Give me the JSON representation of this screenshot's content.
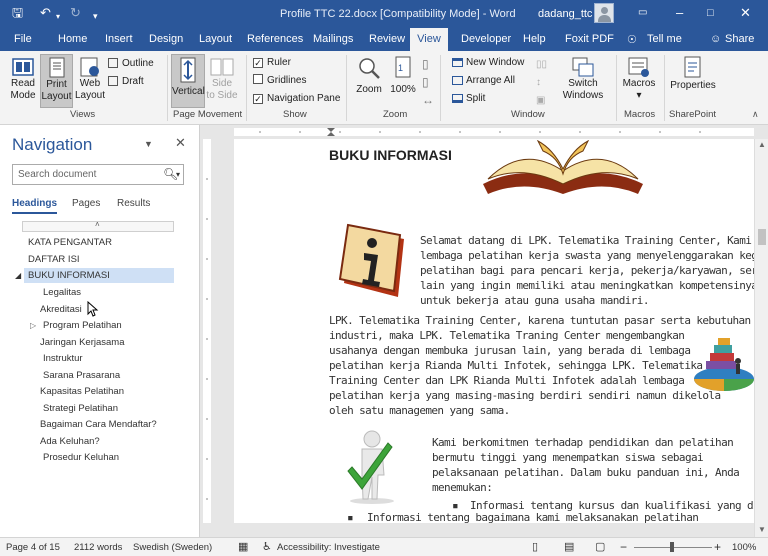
{
  "titlebar": {
    "title": "Profile TTC 22.docx [Compatibility Mode] - Word",
    "user": "dadang_ttc"
  },
  "tabs": [
    "File",
    "Home",
    "Insert",
    "Design",
    "Layout",
    "References",
    "Mailings",
    "Review",
    "View",
    "Developer",
    "Help",
    "Foxit PDF",
    "Tell me",
    "Share"
  ],
  "ribbon": {
    "views": {
      "read_mode": [
        "Read",
        "Mode"
      ],
      "print_layout": [
        "Print",
        "Layout"
      ],
      "web_layout": [
        "Web",
        "Layout"
      ],
      "outline": "Outline",
      "draft": "Draft",
      "group": "Views"
    },
    "page_movement": {
      "vertical": "Vertical",
      "side_to_side": [
        "Side",
        "to Side"
      ],
      "group": "Page Movement"
    },
    "show": {
      "ruler": "Ruler",
      "gridlines": "Gridlines",
      "navigation_pane": "Navigation Pane",
      "group": "Show"
    },
    "zoom": {
      "zoom": "Zoom",
      "percent": "100%",
      "group": "Zoom"
    },
    "window": {
      "new_window": "New Window",
      "arrange_all": "Arrange All",
      "split": "Split",
      "switch_windows": [
        "Switch",
        "Windows"
      ],
      "group": "Window"
    },
    "macros": {
      "label": "Macros",
      "group": "Macros"
    },
    "sharepoint": {
      "label": "Properties",
      "group": "SharePoint"
    }
  },
  "navigation": {
    "title": "Navigation",
    "search_placeholder": "Search document",
    "tabs": [
      "Headings",
      "Pages",
      "Results"
    ],
    "headings": [
      "KATA PENGANTAR",
      "DAFTAR ISI",
      "BUKU INFORMASI",
      "Legalitas",
      "Akreditasi",
      "Program Pelatihan",
      "Jaringan Kerjasama",
      "Instruktur",
      "Sarana Prasarana",
      "Kapasitas Pelatihan",
      "Strategi Pelatihan",
      "Bagaiman Cara Mendaftar?",
      "Ada Keluhan?",
      "Prosedur Keluhan"
    ]
  },
  "document": {
    "heading": "BUKU INFORMASI",
    "para1": [
      "Selamat datang di LPK. Telematika Training Center, Kami ad",
      "lembaga pelatihan kerja swasta yang menyelenggarakan keg",
      "pelatihan bagi para pencari kerja, pekerja/karyawan, serta",
      "lain yang ingin memiliki atau meningkatkan kompetensinya",
      "untuk bekerja atau guna usaha mandiri."
    ],
    "para2": [
      "LPK. Telematika Training Center, karena tuntutan pasar serta kebutuhan",
      "industri, maka LPK.  Telematika Traning Center mengembangkan",
      "usahanya dengan membuka jurusan lain, yang berada di lembaga",
      "pelatihan kerja Rianda Multi Infotek, sehingga LPK. Telematika",
      "Training Center dan LPK Rianda Multi Infotek adalah lembaga",
      "pelatihan kerja yang masing-masing berdiri sendiri namun dikelola",
      "oleh satu managemen yang sama."
    ],
    "para3": [
      "Kami berkomitmen terhadap pendidikan dan pelatihan",
      "bermutu tinggi yang menempatkan siswa sebagai",
      "pelaksanaan pelatihan. Dalam buku panduan ini, Anda",
      "menemukan:"
    ],
    "bullet1": "Informasi tentang kursus dan kualifikasi yang ditawar",
    "bullet2": "Informasi tentang bagaimana kami melaksanakan pelatihan"
  },
  "status": {
    "page": "Page 4 of 15",
    "words": "2112 words",
    "language": "Swedish (Sweden)",
    "accessibility": "Accessibility: Investigate",
    "zoom": "100%"
  }
}
